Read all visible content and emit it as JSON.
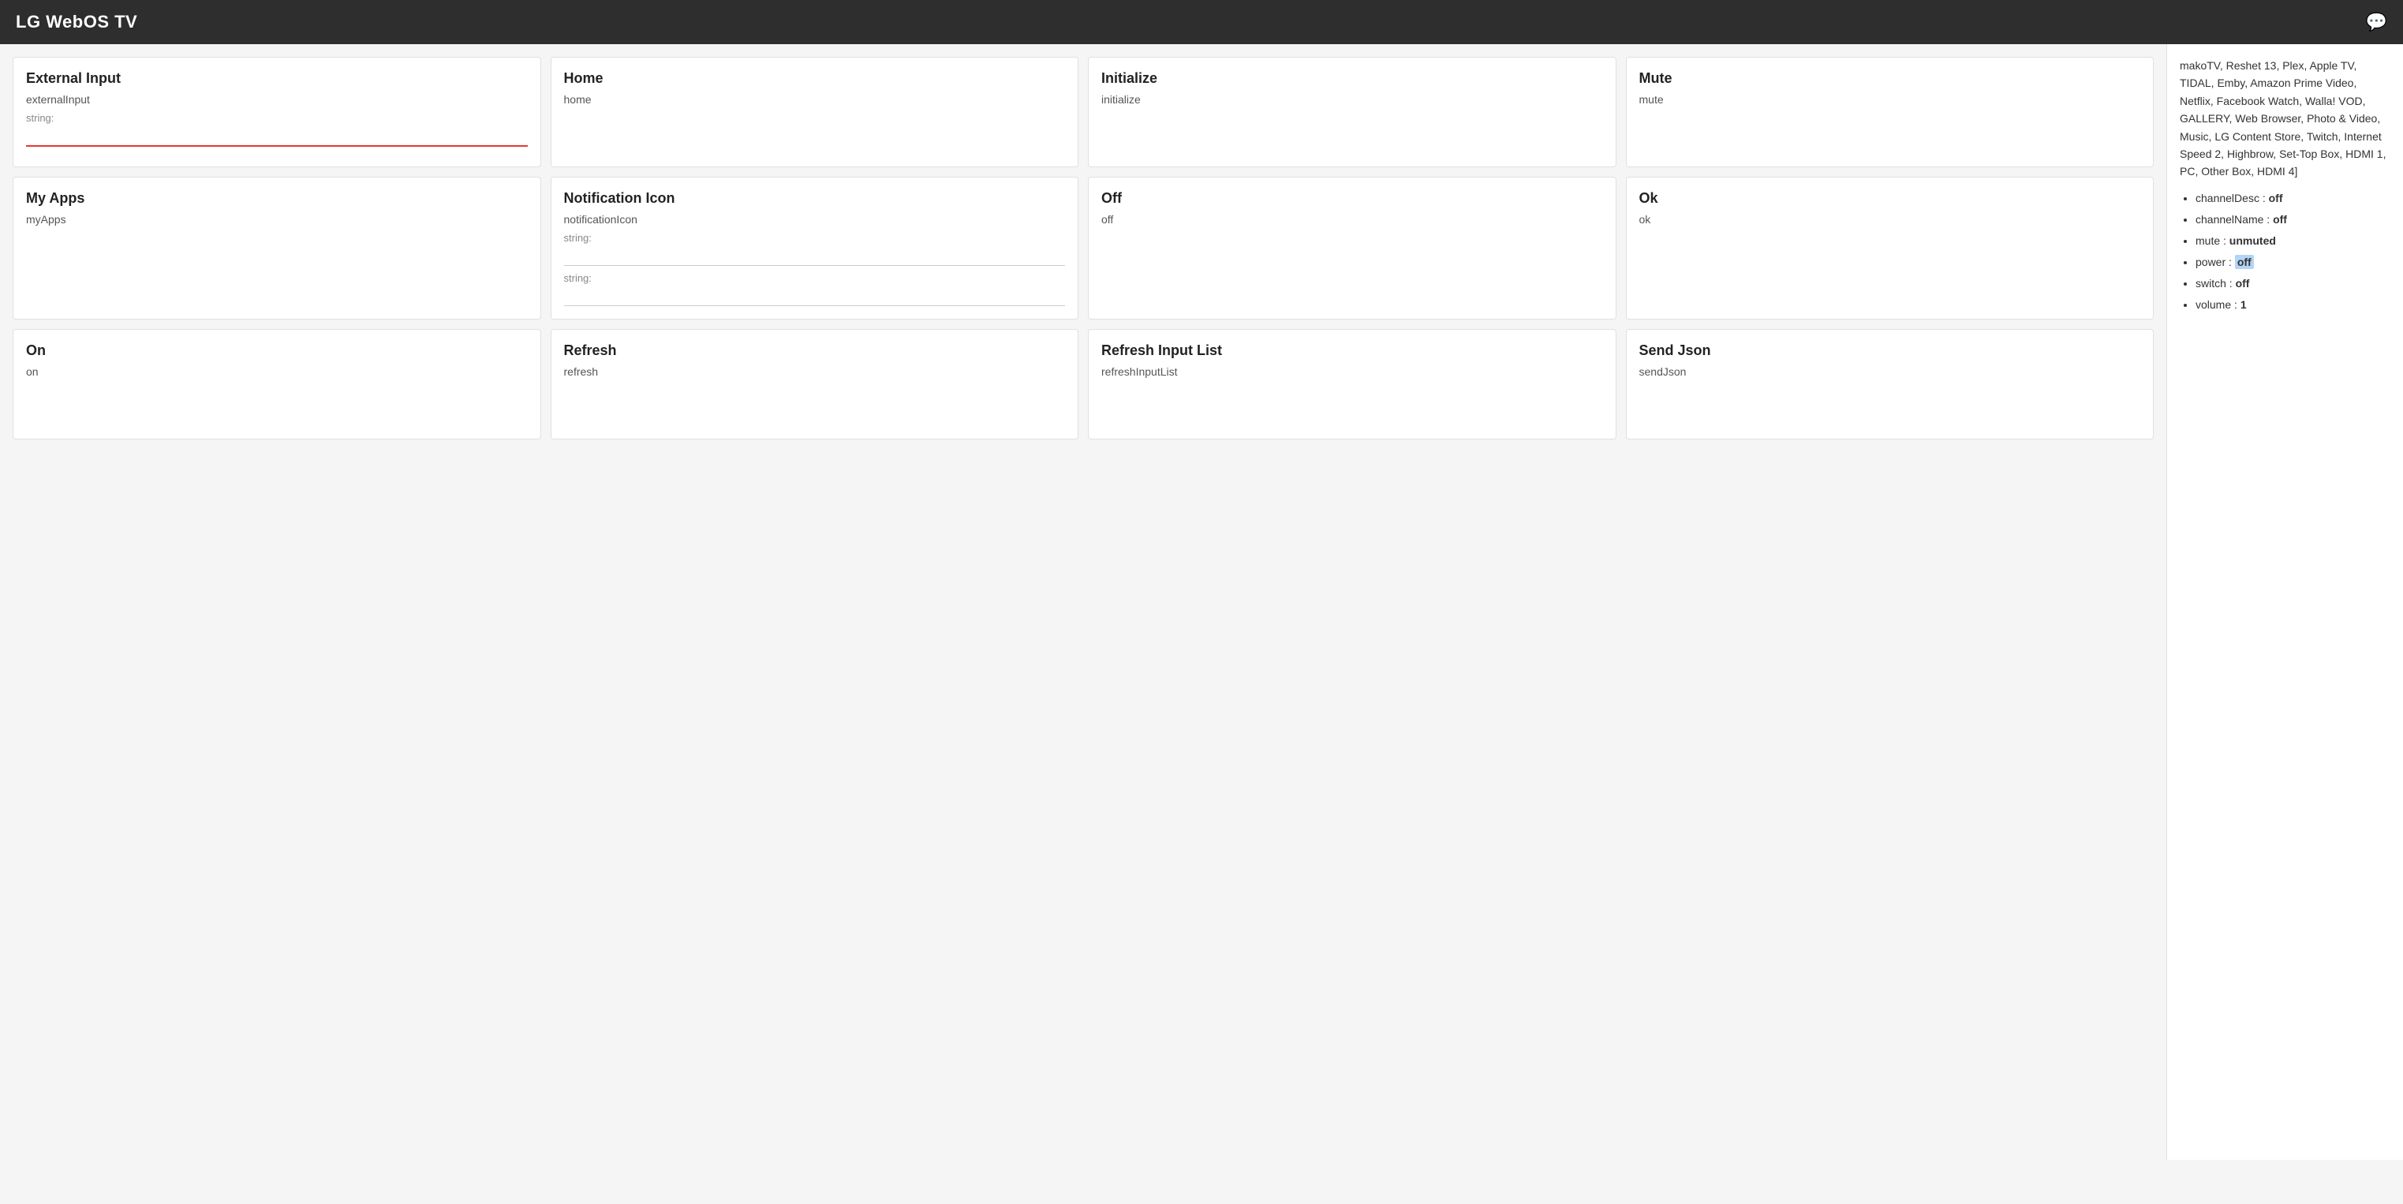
{
  "header": {
    "title": "LG WebOS TV",
    "chat_icon": "💬"
  },
  "right_panel": {
    "channels_text": "makoTV, Reshet 13, Plex, Apple TV, TIDAL, Emby, Amazon Prime Video, Netflix, Facebook Watch, Walla! VOD, GALLERY, Web Browser, Photo & Video, Music, LG Content Store, Twitch, Internet Speed 2, Highbrow, Set-Top Box, HDMI 1, PC, Other Box, HDMI 4]",
    "status_items": [
      {
        "key": "channelDesc",
        "value": "off",
        "bold": true,
        "highlight": false
      },
      {
        "key": "channelName",
        "value": "off",
        "bold": true,
        "highlight": false
      },
      {
        "key": "mute",
        "value": "unmuted",
        "bold": true,
        "highlight": false
      },
      {
        "key": "power",
        "value": "off",
        "bold": true,
        "highlight": true
      },
      {
        "key": "switch",
        "value": "off",
        "bold": true,
        "highlight": false
      },
      {
        "key": "volume",
        "value": "1",
        "bold": true,
        "highlight": false
      }
    ]
  },
  "cards_row1": [
    {
      "title": "External Input",
      "subtitle": "externalInput",
      "label": "string:",
      "has_input": true,
      "input_placeholder": "",
      "input_red": true
    },
    {
      "title": "Home",
      "subtitle": "home",
      "label": "",
      "has_input": false
    },
    {
      "title": "Initialize",
      "subtitle": "initialize",
      "label": "",
      "has_input": false
    },
    {
      "title": "Mute",
      "subtitle": "mute",
      "label": "",
      "has_input": false
    }
  ],
  "cards_row2": [
    {
      "title": "My Apps",
      "subtitle": "myApps",
      "label": "",
      "has_input": false
    },
    {
      "title": "Notification Icon",
      "subtitle": "notificationIcon",
      "label": "string:",
      "has_input": true,
      "input_placeholder": "",
      "input_red": false,
      "label2": "string:",
      "has_input2": true
    },
    {
      "title": "Off",
      "subtitle": "off",
      "label": "",
      "has_input": false
    },
    {
      "title": "Ok",
      "subtitle": "ok",
      "label": "",
      "has_input": false
    }
  ],
  "cards_row3": [
    {
      "title": "On",
      "subtitle": "on",
      "label": "",
      "has_input": false
    },
    {
      "title": "Refresh",
      "subtitle": "refresh",
      "label": "",
      "has_input": false
    },
    {
      "title": "Refresh Input List",
      "subtitle": "refreshInputList",
      "label": "",
      "has_input": false
    },
    {
      "title": "Send Json",
      "subtitle": "sendJson",
      "label": "",
      "has_input": false
    }
  ]
}
